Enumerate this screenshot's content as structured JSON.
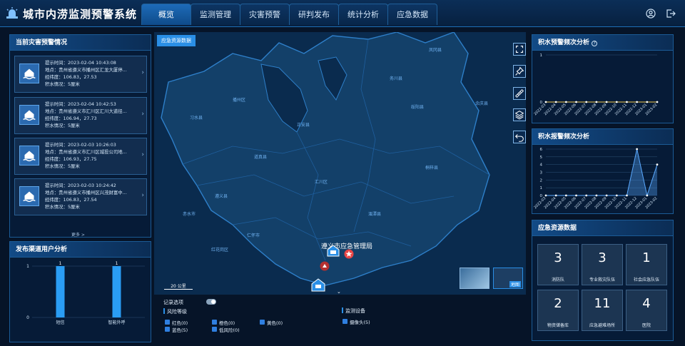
{
  "app": {
    "title": "城市内涝监测预警系统"
  },
  "nav": {
    "tabs": [
      "概览",
      "监测管理",
      "灾害预警",
      "研判发布",
      "统计分析",
      "应急数据"
    ],
    "active": 0
  },
  "alerts": {
    "title": "当前灾害预警情况",
    "items": [
      {
        "time": "提示时间：2023-02-04 10:43:08",
        "place": "地点：贵州省遵义市播州区汇龙大厦停...",
        "coord": "经纬度：106.83，27.53",
        "status": "积水情况：5厘米"
      },
      {
        "time": "提示时间：2023-02-04 10:42:53",
        "place": "地点：贵州省遵义市汇川区汇川大道径...",
        "coord": "经纬度：106.94，27.73",
        "status": "积水情况：5厘米"
      },
      {
        "time": "提示时间：2023-02-03 10:26:03",
        "place": "地点：贵州省遵义市汇川区城投公司地...",
        "coord": "经纬度：106.93，27.75",
        "status": "积水情况：5厘米"
      },
      {
        "time": "提示时间：2023-02-03 10:24:42",
        "place": "地点：贵州省遵义市播州区兴茂财富中...",
        "coord": "经纬度：106.83，27.54",
        "status": "积水情况：5厘米"
      }
    ],
    "more": "更多 >"
  },
  "channels": {
    "title": "发布渠道用户分析",
    "chart_data": {
      "type": "bar",
      "categories": [
        "短信",
        "智能外呼"
      ],
      "values": [
        1,
        1
      ],
      "ylim": [
        0,
        1
      ],
      "yticks": [
        "0",
        "1"
      ],
      "data_labels": [
        "1",
        "1"
      ]
    }
  },
  "map": {
    "layer_button": "应急资源数据",
    "office_label": "遵义市应急管理局",
    "scale": "20 公里",
    "thumb_label": "地图",
    "tools": [
      "fullscreen-icon",
      "pin-icon",
      "ruler-icon",
      "layers-icon",
      "undo-icon"
    ],
    "places": [
      "凤冈县",
      "习水县",
      "余庆县",
      "播州区",
      "绥阳县",
      "遵义县",
      "道真县",
      "汇川区",
      "湄潭县",
      "红花岗区",
      "赤水市",
      "仁怀市",
      "务川县",
      "正安县",
      "桐梓县"
    ]
  },
  "legend": {
    "remember": "记录选项",
    "risk_title": "风险等级",
    "risk": [
      {
        "label": "红色(0)"
      },
      {
        "label": "橙色(0)"
      },
      {
        "label": "黄色(0)"
      },
      {
        "label": "蓝色(5)"
      },
      {
        "label": "低风险(0)"
      }
    ],
    "device_title": "监测设备",
    "devices": [
      {
        "label": "摄像头(5)"
      }
    ]
  },
  "warn_chart": {
    "title": "积水预警频次分析",
    "chart_data": {
      "type": "line",
      "x": [
        "2022-03",
        "2022-04",
        "2022-05",
        "2022-06",
        "2022-07",
        "2022-08",
        "2022-09",
        "2022-10",
        "2022-11",
        "2022-12",
        "2023-01",
        "2023-02"
      ],
      "values": [
        0,
        0,
        0,
        0,
        0,
        0,
        0,
        0,
        0,
        0,
        0,
        0
      ],
      "ylim": [
        0,
        1
      ],
      "yticks": [
        "0",
        "1"
      ]
    }
  },
  "alarm_chart": {
    "title": "积水报警频次分析",
    "chart_data": {
      "type": "area",
      "x": [
        "2022-03",
        "2022-04",
        "2022-05",
        "2022-06",
        "2022-07",
        "2022-08",
        "2022-09",
        "2022-10",
        "2022-11",
        "2022-12",
        "2023-01",
        "2023-02"
      ],
      "values": [
        0,
        0,
        0,
        0,
        0,
        0,
        0,
        0,
        0,
        6,
        0,
        4
      ],
      "ylim": [
        0,
        6
      ],
      "yticks": [
        "0",
        "1",
        "2",
        "3",
        "4",
        "5",
        "6"
      ]
    }
  },
  "resources": {
    "title": "应急资源数据",
    "items": [
      {
        "count": "3",
        "label": "消防队",
        "icon": "firefighter-icon"
      },
      {
        "count": "3",
        "label": "专业救灾队伍",
        "icon": "rescue-team-icon"
      },
      {
        "count": "1",
        "label": "社会应急队伍",
        "icon": "volunteer-icon"
      },
      {
        "count": "2",
        "label": "物资储备库",
        "icon": "warehouse-icon"
      },
      {
        "count": "11",
        "label": "应急避难场所",
        "icon": "shelter-icon"
      },
      {
        "count": "4",
        "label": "医院",
        "icon": "hospital-icon"
      }
    ]
  },
  "colors": {
    "accent": "#2a8fe6",
    "bar": "#2a9df4",
    "warn_line": "#f2c94c",
    "alarm_line": "#5aa9ff"
  }
}
